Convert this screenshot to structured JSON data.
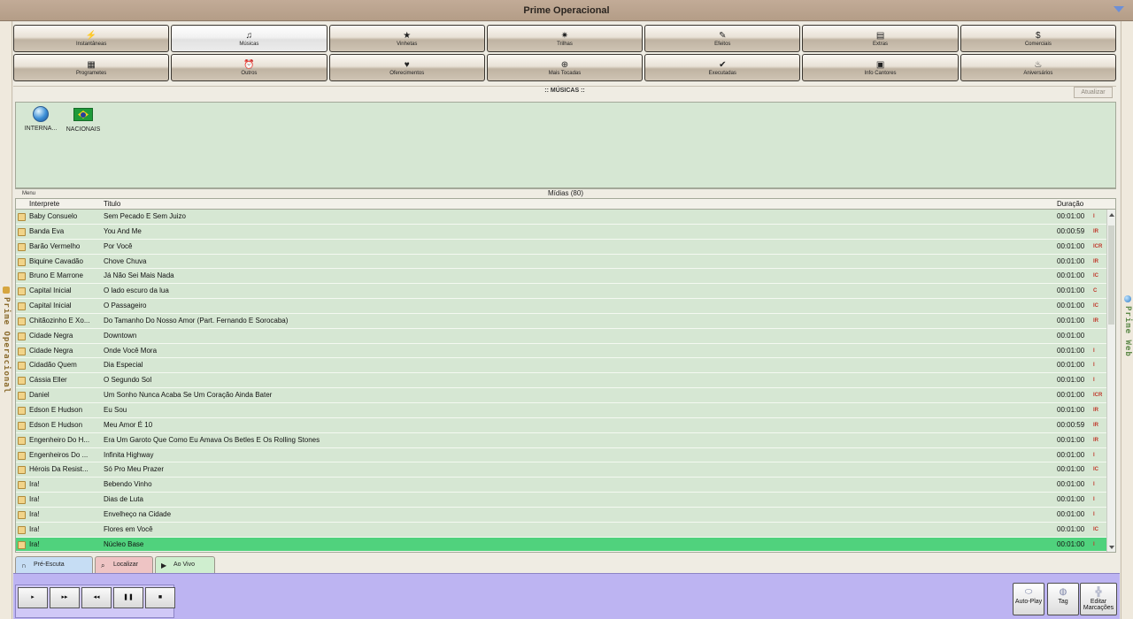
{
  "window": {
    "title": "Prime Operacional"
  },
  "sidebars": {
    "left": "Prime Operacional",
    "right": "Prime Web"
  },
  "toolbar": {
    "row1": [
      {
        "label": "Instantâneas",
        "icon": "lightning-icon",
        "glyph": "⚡"
      },
      {
        "label": "Músicas",
        "icon": "music-note-icon",
        "glyph": "♫",
        "active": true
      },
      {
        "label": "Vinhetas",
        "icon": "star-icon",
        "glyph": "★"
      },
      {
        "label": "Trilhas",
        "icon": "sparkle-icon",
        "glyph": "✷"
      },
      {
        "label": "Efeitos",
        "icon": "magic-wand-icon",
        "glyph": "✎"
      },
      {
        "label": "Extras",
        "icon": "notes-icon",
        "glyph": "▤"
      },
      {
        "label": "Comerciais",
        "icon": "money-icon",
        "glyph": "$"
      }
    ],
    "row2": [
      {
        "label": "Programetes",
        "icon": "film-icon",
        "glyph": "▦"
      },
      {
        "label": "Outros",
        "icon": "alarm-clock-icon",
        "glyph": "⏰"
      },
      {
        "label": "Oferecimentos",
        "icon": "heart-icon",
        "glyph": "♥"
      },
      {
        "label": "Mais Tocadas",
        "icon": "add-circle-icon",
        "glyph": "⊕"
      },
      {
        "label": "Executadas",
        "icon": "checkmark-icon",
        "glyph": "✔"
      },
      {
        "label": "Info Cantores",
        "icon": "id-card-icon",
        "glyph": "▣"
      },
      {
        "label": "Aniversários",
        "icon": "cake-icon",
        "glyph": "♨"
      }
    ]
  },
  "section": {
    "title": ":: MÚSICAS ::",
    "refresh_label": "Atualizar"
  },
  "folders": [
    {
      "label": "INTERNA...",
      "icon": "globe-icon"
    },
    {
      "label": "NACIONAIS",
      "icon": "brazil-flag-icon"
    }
  ],
  "media": {
    "menu_label": "Menu",
    "title": "Mídias (80)"
  },
  "table": {
    "columns": [
      "Interprete",
      "Titulo",
      "Duração"
    ],
    "rows": [
      {
        "artist": "Baby Consuelo",
        "title": "Sem Pecado E Sem Juizo",
        "duration": "00:01:00",
        "flags": "I"
      },
      {
        "artist": "Banda Eva",
        "title": "You And Me",
        "duration": "00:00:59",
        "flags": "IR"
      },
      {
        "artist": "Barão Vermelho",
        "title": "Por Você",
        "duration": "00:01:00",
        "flags": "ICR"
      },
      {
        "artist": "Biquine Cavadão",
        "title": "Chove Chuva",
        "duration": "00:01:00",
        "flags": "IR"
      },
      {
        "artist": "Bruno E Marrone",
        "title": "Já Não Sei Mais Nada",
        "duration": "00:01:00",
        "flags": "IC"
      },
      {
        "artist": "Capital Inicial",
        "title": "O lado escuro da lua",
        "duration": "00:01:00",
        "flags": "C"
      },
      {
        "artist": "Capital Inicial",
        "title": "O Passageiro",
        "duration": "00:01:00",
        "flags": "IC"
      },
      {
        "artist": "Chitãozinho E Xo...",
        "title": "Do Tamanho Do Nosso Amor (Part. Fernando E Sorocaba)",
        "duration": "00:01:00",
        "flags": "IR"
      },
      {
        "artist": "Cidade Negra",
        "title": "Downtown",
        "duration": "00:01:00",
        "flags": ""
      },
      {
        "artist": "Cidade Negra",
        "title": "Onde Você Mora",
        "duration": "00:01:00",
        "flags": "I"
      },
      {
        "artist": "Cidadão Quem",
        "title": "Dia Especial",
        "duration": "00:01:00",
        "flags": "I"
      },
      {
        "artist": "Cássia Eller",
        "title": "O Segundo Sol",
        "duration": "00:01:00",
        "flags": "I"
      },
      {
        "artist": "Daniel",
        "title": "Um Sonho Nunca Acaba Se Um Coração Ainda Bater",
        "duration": "00:01:00",
        "flags": "ICR"
      },
      {
        "artist": "Edson E Hudson",
        "title": "Eu Sou",
        "duration": "00:01:00",
        "flags": "IR"
      },
      {
        "artist": "Edson E Hudson",
        "title": "Meu Amor É 10",
        "duration": "00:00:59",
        "flags": "IR"
      },
      {
        "artist": "Engenheiro Do H...",
        "title": "Era Um Garoto Que Como Eu Amava Os Betles E Os Rolling Stones",
        "duration": "00:01:00",
        "flags": "IR"
      },
      {
        "artist": "Engenheiros Do ...",
        "title": "Infinita Highway",
        "duration": "00:01:00",
        "flags": "I"
      },
      {
        "artist": "Hérois Da Resist...",
        "title": "Só Pro Meu Prazer",
        "duration": "00:01:00",
        "flags": "IC"
      },
      {
        "artist": "Ira!",
        "title": "Bebendo Vinho",
        "duration": "00:01:00",
        "flags": "I"
      },
      {
        "artist": "Ira!",
        "title": "Dias de Luta",
        "duration": "00:01:00",
        "flags": "I"
      },
      {
        "artist": "Ira!",
        "title": "Envelheço na Cidade",
        "duration": "00:01:00",
        "flags": "I"
      },
      {
        "artist": "Ira!",
        "title": "Flores em Você",
        "duration": "00:01:00",
        "flags": "IC"
      },
      {
        "artist": "Ira!",
        "title": "Núcleo Base",
        "duration": "00:01:00",
        "flags": "I",
        "selected": true
      }
    ]
  },
  "tabs": [
    {
      "label": "Pré-Escuta",
      "icon": "headphones-icon",
      "glyph": "∩",
      "color": "#c6ddf4"
    },
    {
      "label": "Localizar",
      "icon": "search-icon",
      "glyph": "⌕",
      "color": "#eec4c4"
    },
    {
      "label": "Ao Vivo",
      "icon": "play-icon",
      "glyph": "▶",
      "color": "#cfeecf"
    }
  ],
  "transport": [
    {
      "label": "▸",
      "name": "play-button"
    },
    {
      "label": "▸▸",
      "name": "next-button"
    },
    {
      "label": "◂◂",
      "name": "previous-button"
    },
    {
      "label": "❚❚",
      "name": "pause-button"
    },
    {
      "label": "■",
      "name": "stop-button"
    }
  ],
  "actions": [
    {
      "label": "Auto-Play",
      "icon": "toggle-icon",
      "glyph": "⬭"
    },
    {
      "label": "Tag",
      "icon": "fingerprint-icon",
      "glyph": "◍"
    },
    {
      "label": "Editar Marcações",
      "icon": "edit-markers-icon",
      "glyph": "╬"
    }
  ],
  "colors": {
    "grid_bg": "#d6e7d3",
    "selected_row": "#50d27d",
    "player_bg": "#bdb4f2",
    "flag_text": "#c0392b"
  }
}
